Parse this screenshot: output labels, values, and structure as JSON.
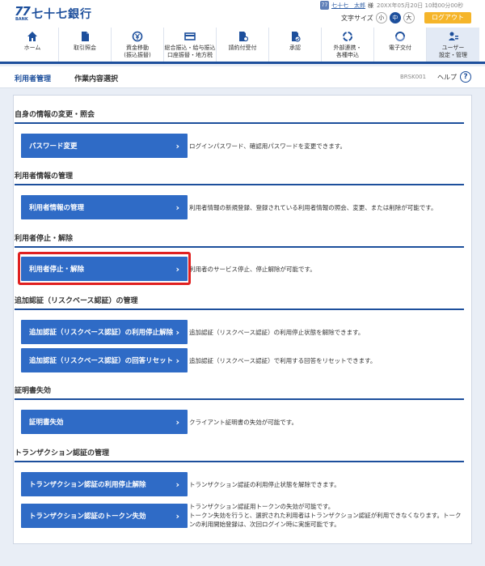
{
  "header": {
    "logo_mark": "77",
    "logo_bank": "BANK",
    "logo_name": "七十七銀行",
    "user_icon": "77",
    "user_name": "七十七　太郎",
    "user_honor": "様",
    "timestamp": "20XX年05月20日 10時00分00秒",
    "font_size_label": "文字サイズ",
    "font_sizes": [
      "小",
      "中",
      "大"
    ],
    "logout_label": "ログアウト"
  },
  "nav": [
    {
      "icon": "home-icon",
      "label": "ホーム"
    },
    {
      "icon": "document-icon",
      "label": "取引照会"
    },
    {
      "icon": "yen-transfer-icon",
      "label": "資金移動\n(振込振替)"
    },
    {
      "icon": "card-icon",
      "label": "総合振込・給与振込\n口座振替・地方税"
    },
    {
      "icon": "request-icon",
      "label": "請約付受付"
    },
    {
      "icon": "approve-icon",
      "label": "承認"
    },
    {
      "icon": "link-icon",
      "label": "外部連携・\n各種申込"
    },
    {
      "icon": "delivery-icon",
      "label": "電子交付"
    },
    {
      "icon": "user-settings-icon",
      "label": "ユーザー\n設定・管理"
    }
  ],
  "titlebar": {
    "main": "利用者管理",
    "sub": "作業内容選択",
    "code": "BRSK001",
    "help": "ヘルプ",
    "help_icon": "?"
  },
  "sections": [
    {
      "title": "自身の情報の変更・照会"
    },
    {
      "title": "利用者情報の管理"
    },
    {
      "title": "利用者停止・解除"
    },
    {
      "title": "追加認証（リスクベース認証）の管理"
    },
    {
      "title": "証明書失効"
    },
    {
      "title": "トランザクション認証の管理"
    }
  ],
  "buttons": [
    {
      "label": "パスワード変更",
      "desc": "ログインパスワード、確認用パスワードを変更できます。"
    },
    {
      "label": "利用者情報の管理",
      "desc": "利用者情報の新規登録、登録されている利用者情報の照会、変更、または削除が可能です。"
    },
    {
      "label": "利用者停止・解除",
      "desc": "利用者のサービス停止、停止解除が可能です。"
    },
    {
      "label": "追加認証（リスクベース認証）の利用停止解除",
      "desc": "追加認証（リスクベース認証）の利用停止状態を解除できます。"
    },
    {
      "label": "追加認証（リスクベース認証）の回答リセット",
      "desc": "追加認証（リスクベース認証）で利用する回答をリセットできます。"
    },
    {
      "label": "証明書失効",
      "desc": "クライアント証明書の失効が可能です。"
    },
    {
      "label": "トランザクション認証の利用停止解除",
      "desc": "トランザクション認証の利用停止状態を解除できます。"
    },
    {
      "label": "トランザクション認証のトークン失効",
      "desc": "トランザクション認証用トークンの失効が可能です。\nトークン失効を行うと、選択された利用者はトランザクション認証が利用できなくなります。トークンの利用開始登録は、次回ログイン時に実施可能です。"
    }
  ],
  "colors": {
    "brand": "#1d4f9c",
    "button": "#2f6bc6",
    "logout": "#f5b52a",
    "highlight": "#e02020"
  }
}
